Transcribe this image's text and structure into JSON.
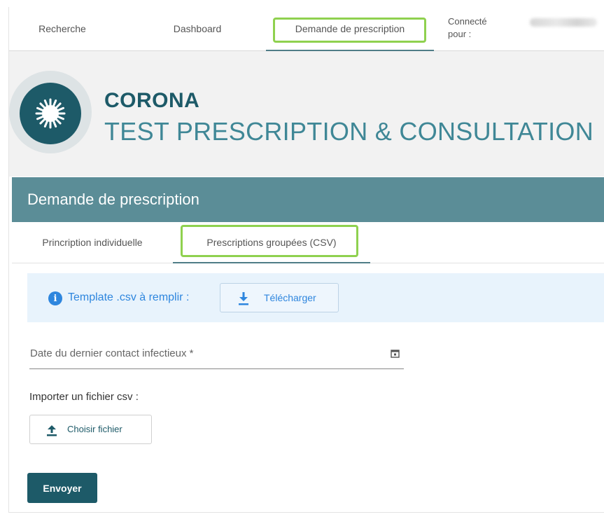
{
  "nav": {
    "items": [
      {
        "label": "Recherche"
      },
      {
        "label": "Dashboard"
      },
      {
        "label": "Demande de prescription"
      }
    ],
    "connected_label": "Connecté\npour :"
  },
  "brand": {
    "title": "CORONA",
    "subtitle": "TEST PRESCRIPTION & CONSULTATION",
    "logo_icon": "virus-icon"
  },
  "panel": {
    "title": "Demande de prescription"
  },
  "tabs": [
    {
      "label": "Princription individuelle"
    },
    {
      "label": "Prescriptions groupées (CSV)"
    }
  ],
  "info": {
    "icon": "info-icon",
    "text": "Template .csv à remplir :",
    "download_label": "Télécharger"
  },
  "form": {
    "date_label": "Date du dernier contact infectieux *",
    "import_label": "Importer un fichier csv :",
    "choose_label": "Choisir fichier",
    "submit_label": "Envoyer"
  },
  "colors": {
    "primary": "#1d5a68",
    "panel_header": "#5b8d97",
    "highlight": "#8fd14f",
    "info": "#2e86de"
  }
}
